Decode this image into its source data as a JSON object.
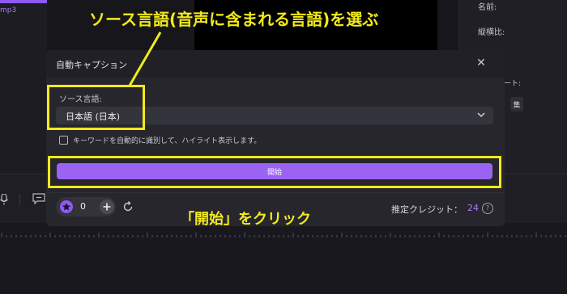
{
  "background": {
    "top_left_tag": "mp3",
    "right_panel": {
      "name_label": "名前:",
      "aspect_label": "縦横比:",
      "rate_label": "ート:",
      "button_label": "集"
    }
  },
  "dialog": {
    "title": "自動キャプション",
    "close_icon": "close-icon",
    "source_language_label": "ソース言語:",
    "source_language_value": "日本語 (日本)",
    "checkbox_label": "キーワードを自動的に識別して、ハイライト表示します。",
    "start_button": "開始",
    "star_count": "0",
    "credit_label": "推定クレジット：",
    "credit_value": "24",
    "help_icon": "?"
  },
  "annotations": {
    "top": "ソース言語(音声に含まれる言語)を選ぶ",
    "bottom": "「開始」をクリック"
  },
  "colors": {
    "accent": "#9b63f2",
    "highlight": "#f2ea1a",
    "credit": "#a77cf5"
  }
}
